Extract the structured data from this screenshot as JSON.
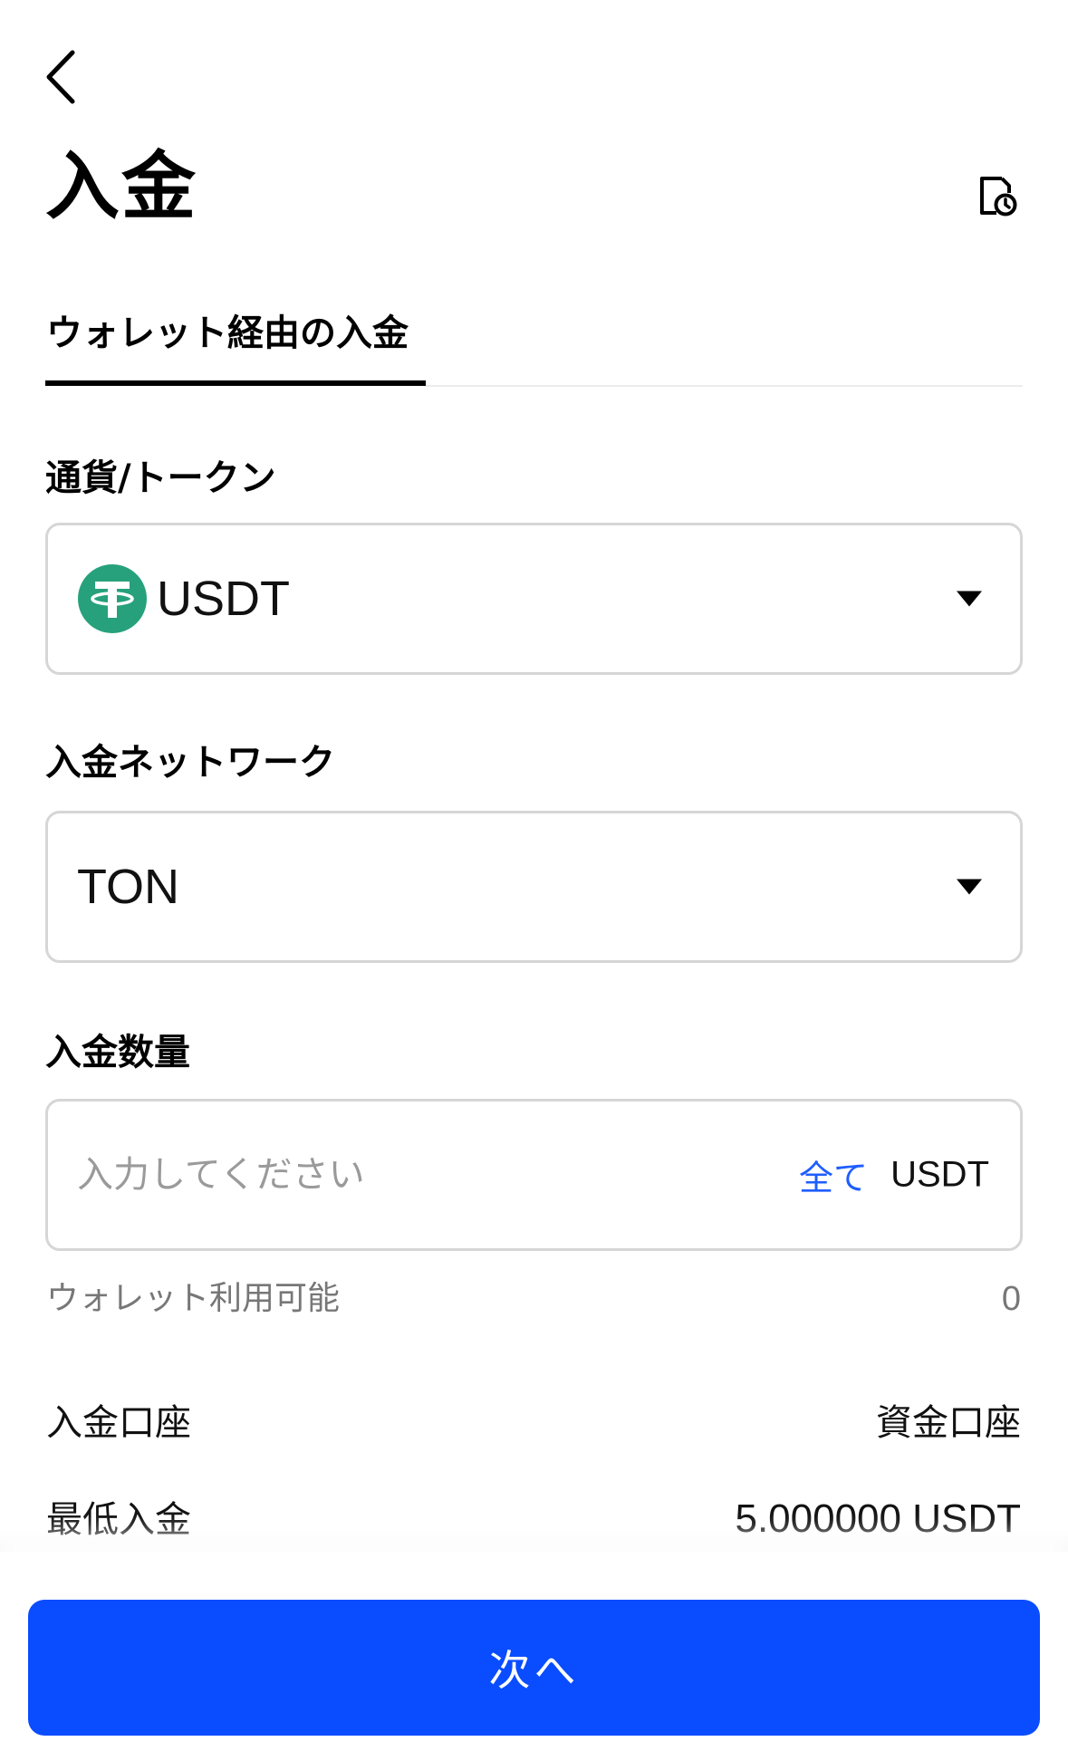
{
  "header": {
    "title": "入金"
  },
  "tabs": [
    {
      "label": "ウォレット経由の入金",
      "active": true
    }
  ],
  "currency": {
    "label": "通貨/トークン",
    "selected": "USDT",
    "icon": "tether-icon",
    "icon_color": "#26a17b"
  },
  "network": {
    "label": "入金ネットワーク",
    "selected": "TON"
  },
  "amount": {
    "label": "入金数量",
    "placeholder": "入力してください",
    "value": "",
    "max_label": "全て",
    "unit": "USDT"
  },
  "wallet_available": {
    "label": "ウォレット利用可能",
    "value": "0"
  },
  "details": {
    "account_label": "入金口座",
    "account_value": "資金口座",
    "minimum_label": "最低入金",
    "minimum_value": "5.000000 USDT"
  },
  "footer": {
    "next_label": "次へ",
    "button_color": "#0a4cff",
    "link_color": "#1e5dff"
  }
}
